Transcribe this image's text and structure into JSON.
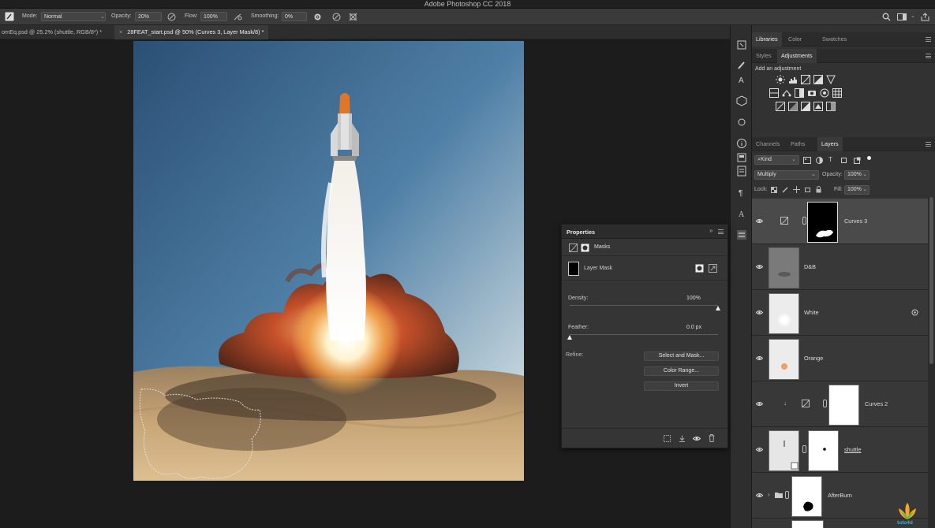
{
  "app": {
    "title": "Adobe Photoshop CC 2018"
  },
  "options_bar": {
    "mode_label": "Mode:",
    "mode_value": "Normal",
    "opacity_label": "Opacity:",
    "opacity_value": "20%",
    "flow_label": "Flow:",
    "flow_value": "100%",
    "smoothing_label": "Smoothing:",
    "smoothing_value": "0%"
  },
  "doc_tabs": [
    {
      "label": "omEq.psd @ 25.2% (shuttle, RGB/8*) *",
      "active": false
    },
    {
      "label": "28FEAT_start.psd @ 50% (Curves 3, Layer Mask/8) *",
      "active": true
    }
  ],
  "top_panel": {
    "tabs": [
      "Libraries",
      "Color",
      "Swatches"
    ],
    "subtabs": [
      "Styles",
      "Adjustments"
    ],
    "adjust_title": "Add an adjustment"
  },
  "layers_panel": {
    "tabs": [
      "Channels",
      "Paths",
      "Layers"
    ],
    "filter_value": "Kind",
    "blend_mode": "Multiply",
    "opacity_label": "Opacity:",
    "opacity_value": "100%",
    "lock_label": "Lock:",
    "fill_label": "Fill:",
    "fill_value": "100%",
    "layers": [
      {
        "name": "Curves 3",
        "selected": true,
        "kind": "adjustment-mask"
      },
      {
        "name": "D&B",
        "selected": false,
        "kind": "pixel"
      },
      {
        "name": "White",
        "selected": false,
        "kind": "pixel"
      },
      {
        "name": "Orange",
        "selected": false,
        "kind": "pixel"
      },
      {
        "name": "Curves 2",
        "selected": false,
        "kind": "adjustment-mask"
      },
      {
        "name": "shuttle",
        "selected": false,
        "kind": "smart-mask"
      },
      {
        "name": "AfterBurn",
        "selected": false,
        "kind": "group-mask"
      }
    ]
  },
  "properties": {
    "title": "Properties",
    "section": "Masks",
    "item": "Layer Mask",
    "density_label": "Density:",
    "density_value": "100%",
    "density_level": 1.0,
    "feather_label": "Feather:",
    "feather_value": "0.0 px",
    "feather_level": 0.0,
    "refine_label": "Refine:",
    "buttons": [
      "Select and Mask...",
      "Color Range...",
      "Invert"
    ]
  },
  "watermark": {
    "text": "tuto4d"
  },
  "colors": {
    "accent": "#ffffff",
    "panel": "#323232",
    "canvas_bg": "#1c1c1c"
  }
}
